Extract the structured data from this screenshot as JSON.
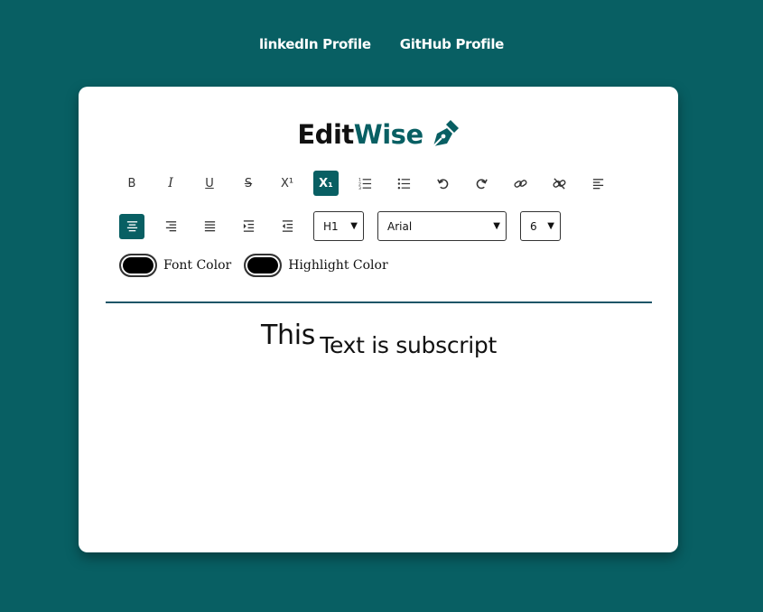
{
  "nav": {
    "linkedin": "linkedIn Profile",
    "github": "GitHub Profile"
  },
  "brand": {
    "part1": "Edit",
    "part2": "Wise",
    "color_dark": "#111111",
    "color_accent": "#085f63"
  },
  "toolbar": {
    "bold": "B",
    "italic": "I",
    "underline": "U",
    "strike": "S",
    "superscript": "X¹",
    "subscript": "X₁",
    "heading_value": "H1",
    "font_value": "Arial",
    "size_value": "6",
    "active_tool": "subscript",
    "align_center_active": true
  },
  "colors": {
    "font_label": "Font Color",
    "highlight_label": "Highlight Color",
    "font_value": "#000000",
    "highlight_value": "#000000"
  },
  "editor": {
    "main_text": "This",
    "sub_text": "Text is subscript"
  }
}
